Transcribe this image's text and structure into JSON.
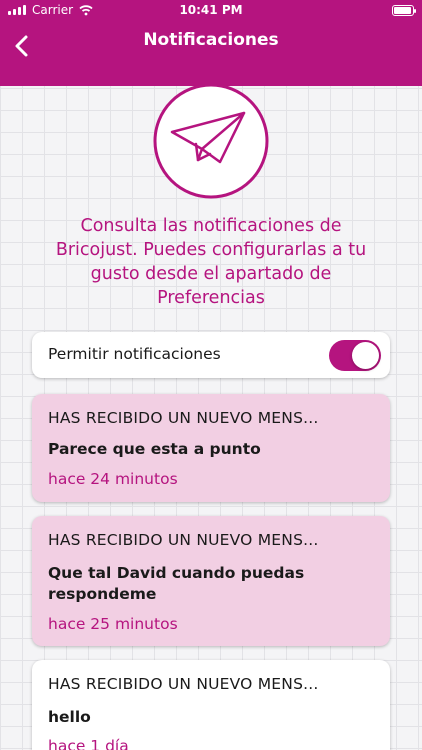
{
  "status_bar": {
    "carrier": "Carrier",
    "time": "10:41 PM"
  },
  "header": {
    "title": "Notificaciones",
    "back_icon": "chevron-left-icon"
  },
  "hero": {
    "icon": "paper-plane-icon"
  },
  "intro_text": "Consulta las notificaciones de Bricojust. Puedes configurarlas a tu gusto desde el apartado de Preferencias",
  "toggle": {
    "label": "Permitir notificaciones",
    "enabled": true
  },
  "notifications": [
    {
      "title": "HAS RECIBIDO UN NUEVO MENS...",
      "message": "Parece que esta a punto",
      "time": "hace 24 minutos",
      "unread": true
    },
    {
      "title": "HAS RECIBIDO UN NUEVO MENS...",
      "message": "Que tal David cuando puedas respondeme",
      "time": "hace 25 minutos",
      "unread": true
    },
    {
      "title": "HAS RECIBIDO UN NUEVO MENS...",
      "message": "hello",
      "time": "hace 1 día",
      "unread": false
    }
  ],
  "colors": {
    "accent": "#b5147f",
    "unread_bg": "#f2cfe3",
    "read_bg": "#ffffff"
  }
}
